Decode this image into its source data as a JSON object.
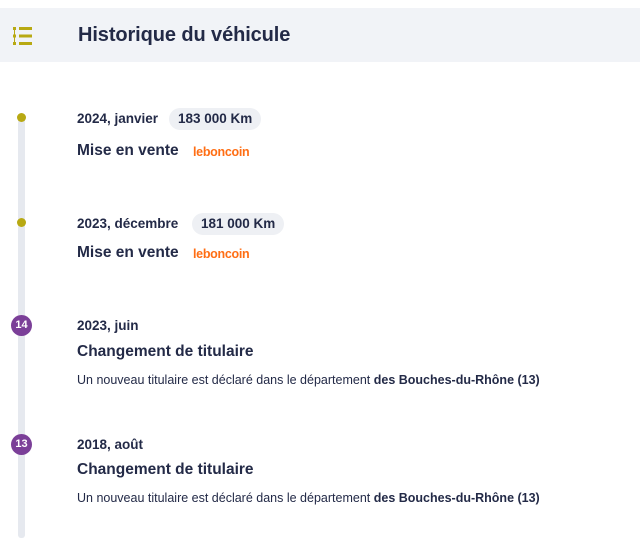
{
  "header": {
    "title": "Historique du véhicule",
    "icon": "timeline-list-icon",
    "accent_color": "#b8a913",
    "background_color": "#f1f3f7"
  },
  "timeline": [
    {
      "marker_type": "dot",
      "date": "2024, janvier",
      "mileage": "183 000 Km",
      "title": "Mise en vente",
      "source": "leboncoin"
    },
    {
      "marker_type": "dot",
      "date": "2023, décembre",
      "mileage": "181 000 Km",
      "title": "Mise en vente",
      "source": "leboncoin"
    },
    {
      "marker_type": "number",
      "marker": "14",
      "date": "2023, juin",
      "title": "Changement de titulaire",
      "description": "Un nouveau titulaire est déclaré dans le département",
      "department": "des Bouches-du-Rhône (13)"
    },
    {
      "marker_type": "number",
      "marker": "13",
      "date": "2018, août",
      "title": "Changement de titulaire",
      "description": "Un nouveau titulaire est déclaré dans le département",
      "department": "des Bouches-du-Rhône (13)"
    }
  ],
  "colors": {
    "dot": "#b8a913",
    "number_badge": "#7b3f98",
    "brand": "#ff6e14",
    "text": "#232a47"
  }
}
